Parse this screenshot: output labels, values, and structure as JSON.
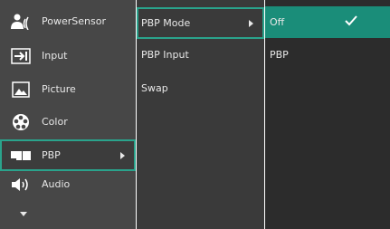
{
  "main_menu": {
    "items": [
      {
        "label": "PowerSensor",
        "icon": "power-sensor-icon"
      },
      {
        "label": "Input",
        "icon": "input-icon"
      },
      {
        "label": "Picture",
        "icon": "picture-icon"
      },
      {
        "label": "Color",
        "icon": "color-icon"
      },
      {
        "label": "PBP",
        "icon": "pbp-icon"
      },
      {
        "label": "Audio",
        "icon": "audio-icon"
      }
    ],
    "selected": "PBP",
    "more_indicator": "scroll-down-arrow-icon"
  },
  "sub_menu": {
    "items": [
      {
        "label": "PBP Mode"
      },
      {
        "label": "PBP Input"
      },
      {
        "label": "Swap"
      }
    ],
    "focused": "PBP Mode"
  },
  "options": {
    "items": [
      {
        "label": "Off",
        "selected": true
      },
      {
        "label": "PBP",
        "selected": false
      }
    ]
  },
  "colors": {
    "accent": "#2aa38c",
    "active_option": "#1a8d79",
    "panel_left": "#474747",
    "panel_middle": "#3a3a3a",
    "panel_right": "#2c2c2c",
    "text": "#e8e8e8"
  }
}
